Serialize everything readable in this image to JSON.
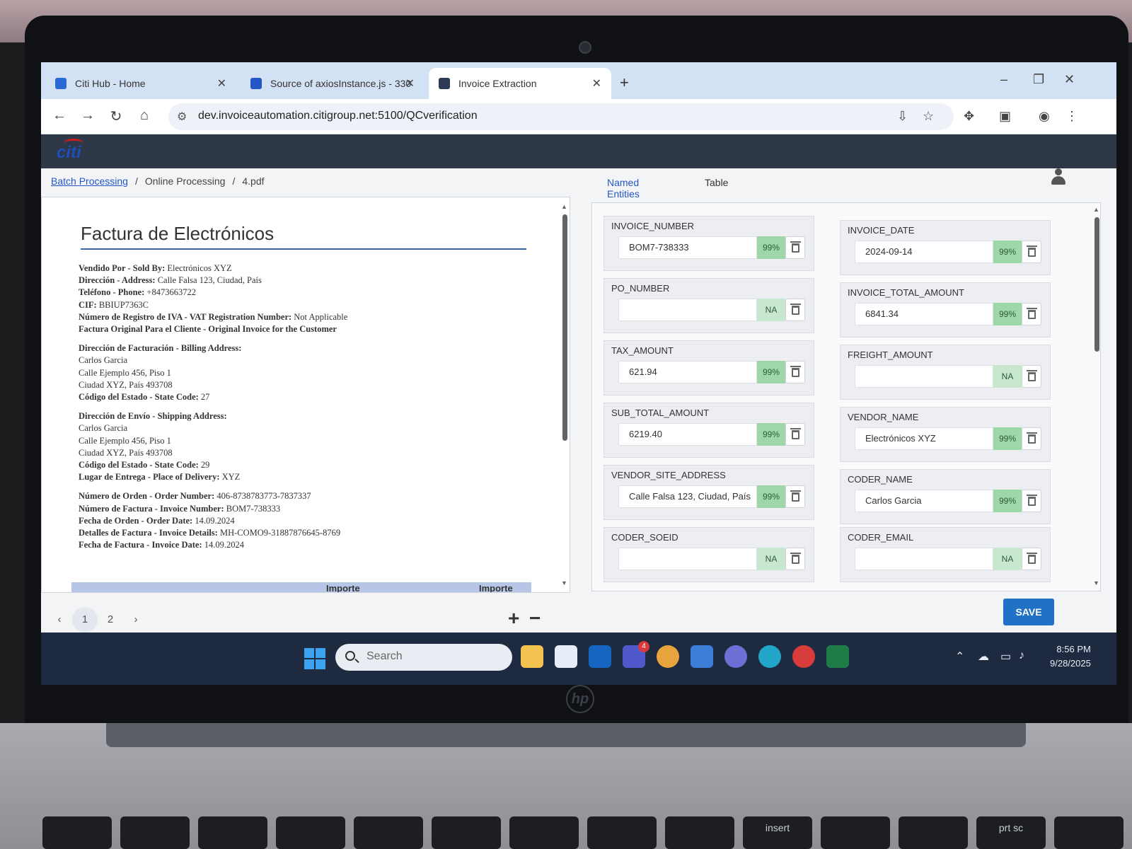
{
  "browser": {
    "tabs": [
      {
        "title": "Citi Hub - Home",
        "favicon_color": "#2a6ad4"
      },
      {
        "title": "Source of axiosInstance.js - 330",
        "favicon_color": "#2457c5"
      },
      {
        "title": "Invoice Extraction",
        "favicon_color": "#2b3a55"
      }
    ],
    "new_tab": "+",
    "url": "dev.invoiceautomation.citigroup.net:5100/QCverification"
  },
  "app": {
    "logo": "citi",
    "breadcrumb": {
      "link": "Batch Processing",
      "sep": "/",
      "current": "Online Processing",
      "file": "4.pdf"
    }
  },
  "document": {
    "title": "Factura de Electrónicos",
    "header_lines": [
      {
        "label": "Vendido Por - Sold By:",
        "value": "Electrónicos XYZ"
      },
      {
        "label": "Dirección - Address:",
        "value": "Calle Falsa 123, Ciudad, País"
      },
      {
        "label": "Teléfono - Phone:",
        "value": "+8473663722"
      },
      {
        "label": "CIF:",
        "value": "BBIUP7363C"
      },
      {
        "label": "Número de Registro de IVA - VAT Registration Number:",
        "value": "Not Applicable"
      },
      {
        "label": "Factura Original Para el Cliente - Original Invoice for the Customer",
        "value": ""
      }
    ],
    "billing": {
      "heading": "Dirección de Facturación - Billing Address:",
      "lines": [
        "Carlos Garcia",
        "Calle Ejemplo 456, Piso 1",
        "Ciudad XYZ, País 493708"
      ],
      "state_label": "Código del Estado - State Code:",
      "state_value": "27"
    },
    "shipping": {
      "heading": "Dirección de Envío - Shipping Address:",
      "lines": [
        "Carlos Garcia",
        "Calle Ejemplo 456, Piso 1",
        "Ciudad XYZ, País 493708"
      ],
      "state_label": "Código del Estado - State Code:",
      "state_value": "29",
      "place_label": "Lugar de Entrega - Place of Delivery:",
      "place_value": "XYZ"
    },
    "order_lines": [
      {
        "label": "Número de Orden - Order Number:",
        "value": "406-8738783773-7837337"
      },
      {
        "label": "Número de Factura - Invoice Number:",
        "value": "BOM7-738333"
      },
      {
        "label": "Fecha de Orden - Order Date:",
        "value": "14.09.2024"
      },
      {
        "label": "Detalles de Factura - Invoice Details:",
        "value": "MH-COMO9-31887876645-8769"
      },
      {
        "label": "Fecha de Factura - Invoice Date:",
        "value": "14.09.2024"
      }
    ],
    "table_headers": [
      "Importe",
      "Importe"
    ]
  },
  "pager": {
    "prev": "‹",
    "pages": [
      "1",
      "2"
    ],
    "next": "›",
    "zoom_in": "+",
    "zoom_out": "−"
  },
  "panel": {
    "tabs": [
      "Named Entities",
      "Table"
    ],
    "fields": [
      {
        "label": "INVOICE_NUMBER",
        "value": "BOM7-738333",
        "confidence": "99%"
      },
      {
        "label": "INVOICE_DATE",
        "value": "2024-09-14",
        "confidence": "99%"
      },
      {
        "label": "PO_NUMBER",
        "value": "",
        "confidence": "NA"
      },
      {
        "label": "INVOICE_TOTAL_AMOUNT",
        "value": "6841.34",
        "confidence": "99%"
      },
      {
        "label": "TAX_AMOUNT",
        "value": "621.94",
        "confidence": "99%"
      },
      {
        "label": "FREIGHT_AMOUNT",
        "value": "",
        "confidence": "NA"
      },
      {
        "label": "SUB_TOTAL_AMOUNT",
        "value": "6219.40",
        "confidence": "99%"
      },
      {
        "label": "VENDOR_NAME",
        "value": "Electrónicos XYZ",
        "confidence": "99%"
      },
      {
        "label": "VENDOR_SITE_ADDRESS",
        "value": "Calle Falsa 123, Ciudad, País",
        "confidence": "99%"
      },
      {
        "label": "CODER_NAME",
        "value": "Carlos Garcia",
        "confidence": "99%"
      },
      {
        "label": "CODER_SOEID",
        "value": "",
        "confidence": "NA"
      },
      {
        "label": "CODER_EMAIL",
        "value": "",
        "confidence": "NA"
      }
    ],
    "save_label": "SAVE"
  },
  "taskbar": {
    "search_placeholder": "Search",
    "teams_badge": "4",
    "time": "8:56 PM",
    "date": "9/28/2025"
  },
  "keyboard": {
    "insert_label": "insert",
    "prtsc_label": "prt sc"
  }
}
